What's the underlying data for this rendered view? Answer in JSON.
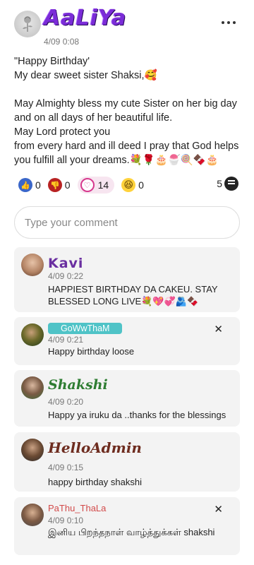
{
  "post": {
    "author": "AaLiYa",
    "time": "4/09 0:08",
    "line1": "\"Happy Birthday'",
    "line2": "My dear sweet sister Shaksi,🥰",
    "line3": "May Almighty bless my cute Sister on her big day and on all days of her beautiful life.",
    "line4": "May Lord protect you",
    "line5": "from every hard and ill deed I pray that God helps you fulfill all your dreams.💐🌹🎂🍧🍭🍫🎂"
  },
  "reactions": {
    "like": "0",
    "dislike": "0",
    "love": "14",
    "haha": "0",
    "comments": "5"
  },
  "composer": {
    "placeholder": "Type your comment"
  },
  "comments": [
    {
      "name": "Kavi",
      "time": "4/09 0:22",
      "text": "HAPPIEST BIRTHDAY DA CAKEU. STAY BLESSED LONG LIVE💐💖💞🫂🍫"
    },
    {
      "name": "GoWwThaM",
      "time": "4/09 0:21",
      "text": "Happy birthday loose",
      "close": "✕"
    },
    {
      "name": "Shakshi",
      "time": "4/09 0:20",
      "text": "Happy ya iruku da ..thanks for the blessings"
    },
    {
      "name": "HelloAdmin",
      "time": "4/09 0:15",
      "text": "happy birthday shakshi"
    },
    {
      "name": "PaThu_ThaLa",
      "time": "4/09 0:10",
      "text": "இனிய பிறந்தநாள் வாழ்த்துக்கள் shakshi",
      "close": "✕"
    }
  ]
}
